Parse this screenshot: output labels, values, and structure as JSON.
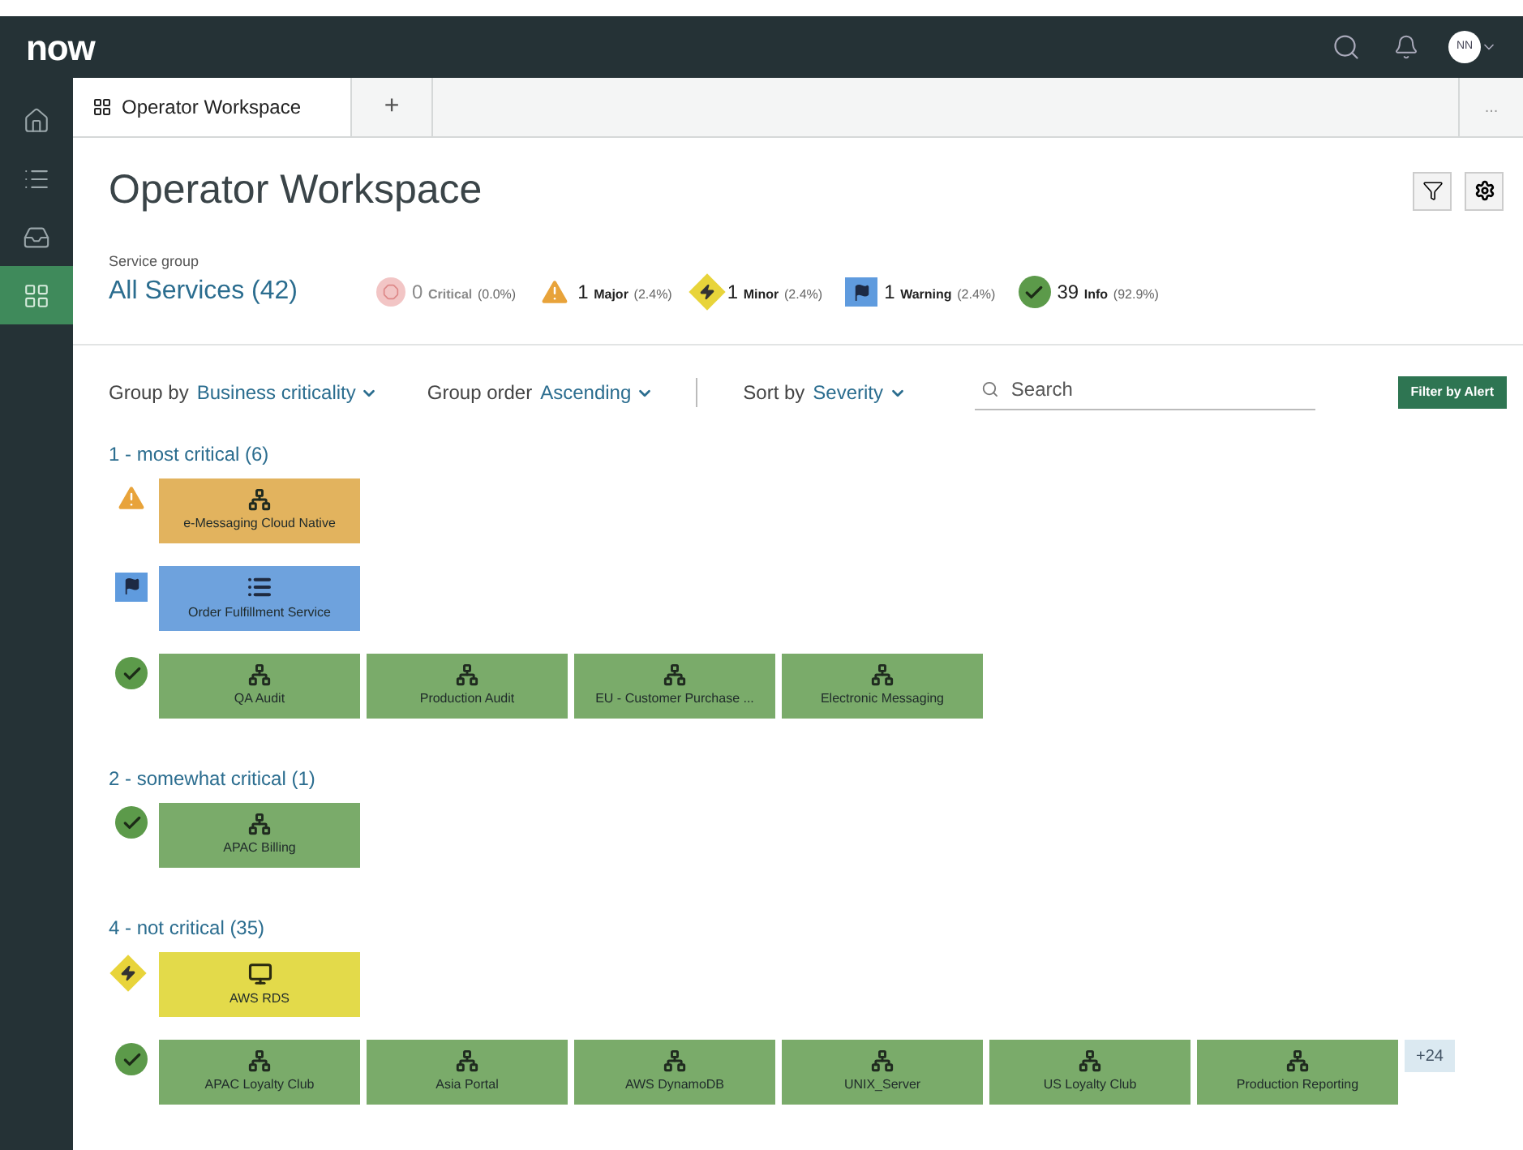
{
  "header": {
    "logo": "now",
    "avatar": "NN"
  },
  "sidebar": {
    "items": [
      {
        "kind": "home",
        "selected": false
      },
      {
        "kind": "list",
        "selected": false
      },
      {
        "kind": "inbox",
        "selected": false
      },
      {
        "kind": "grid",
        "selected": true
      }
    ]
  },
  "tabs": [
    {
      "label": "Operator Workspace",
      "kind": "page",
      "selected": true
    },
    {
      "label": "+",
      "kind": "add",
      "selected": false
    }
  ],
  "tab_overflow": "...",
  "page_title": "Operator Workspace",
  "summary": {
    "label": "Service group",
    "value": "All Services (42)",
    "counts": [
      {
        "kind": "critical",
        "count": "0",
        "label": "Critical",
        "percent": "(0.0%)",
        "disabled": true
      },
      {
        "kind": "major",
        "count": "1",
        "label": "Major",
        "percent": "(2.4%)",
        "disabled": false
      },
      {
        "kind": "minor",
        "count": "1",
        "label": "Minor",
        "percent": "(2.4%)",
        "disabled": false
      },
      {
        "kind": "warning",
        "count": "1",
        "label": "Warning",
        "percent": "(2.4%)",
        "disabled": false
      },
      {
        "kind": "info",
        "count": "39",
        "label": "Info",
        "percent": "(92.9%)",
        "disabled": false
      }
    ]
  },
  "toolbar": {
    "controls": [
      {
        "label": "Group by",
        "value": "Business criticality"
      },
      {
        "label": "Group order",
        "value": "Ascending"
      },
      {
        "label": "Sort by",
        "value": "Severity"
      }
    ],
    "search": {
      "placeholder": "Search"
    },
    "button": "Filter by Alert"
  },
  "groups": [
    {
      "title": "1 - most critical (6)",
      "rows": [
        {
          "kind": "major",
          "tiles": [
            {
              "name": "e-Messaging Cloud Native",
              "kind": "hierarchy"
            }
          ]
        },
        {
          "kind": "warning",
          "tiles": [
            {
              "name": "Order Fulfillment Service",
              "kind": "list"
            }
          ]
        },
        {
          "kind": "info",
          "tiles": [
            {
              "name": "QA Audit",
              "kind": "hierarchy"
            },
            {
              "name": "Production Audit",
              "kind": "hierarchy"
            },
            {
              "name": "EU - Customer Purchase ...",
              "kind": "hierarchy"
            },
            {
              "name": "Electronic Messaging",
              "kind": "hierarchy"
            }
          ]
        }
      ]
    },
    {
      "title": "2 - somewhat critical (1)",
      "rows": [
        {
          "kind": "info",
          "tiles": [
            {
              "name": "APAC Billing",
              "kind": "hierarchy"
            }
          ]
        }
      ]
    },
    {
      "title": "4 - not critical (35)",
      "rows": [
        {
          "kind": "minor",
          "tiles": [
            {
              "name": "AWS RDS",
              "kind": "monitor"
            }
          ]
        },
        {
          "kind": "info",
          "more": "+24",
          "tiles": [
            {
              "name": "APAC Loyalty Club",
              "kind": "hierarchy"
            },
            {
              "name": "Asia Portal",
              "kind": "hierarchy"
            },
            {
              "name": "AWS DynamoDB",
              "kind": "hierarchy"
            },
            {
              "name": "UNIX_Server",
              "kind": "hierarchy"
            },
            {
              "name": "US Loyalty Club",
              "kind": "hierarchy"
            },
            {
              "name": "Production Reporting",
              "kind": "hierarchy"
            }
          ]
        }
      ]
    }
  ]
}
